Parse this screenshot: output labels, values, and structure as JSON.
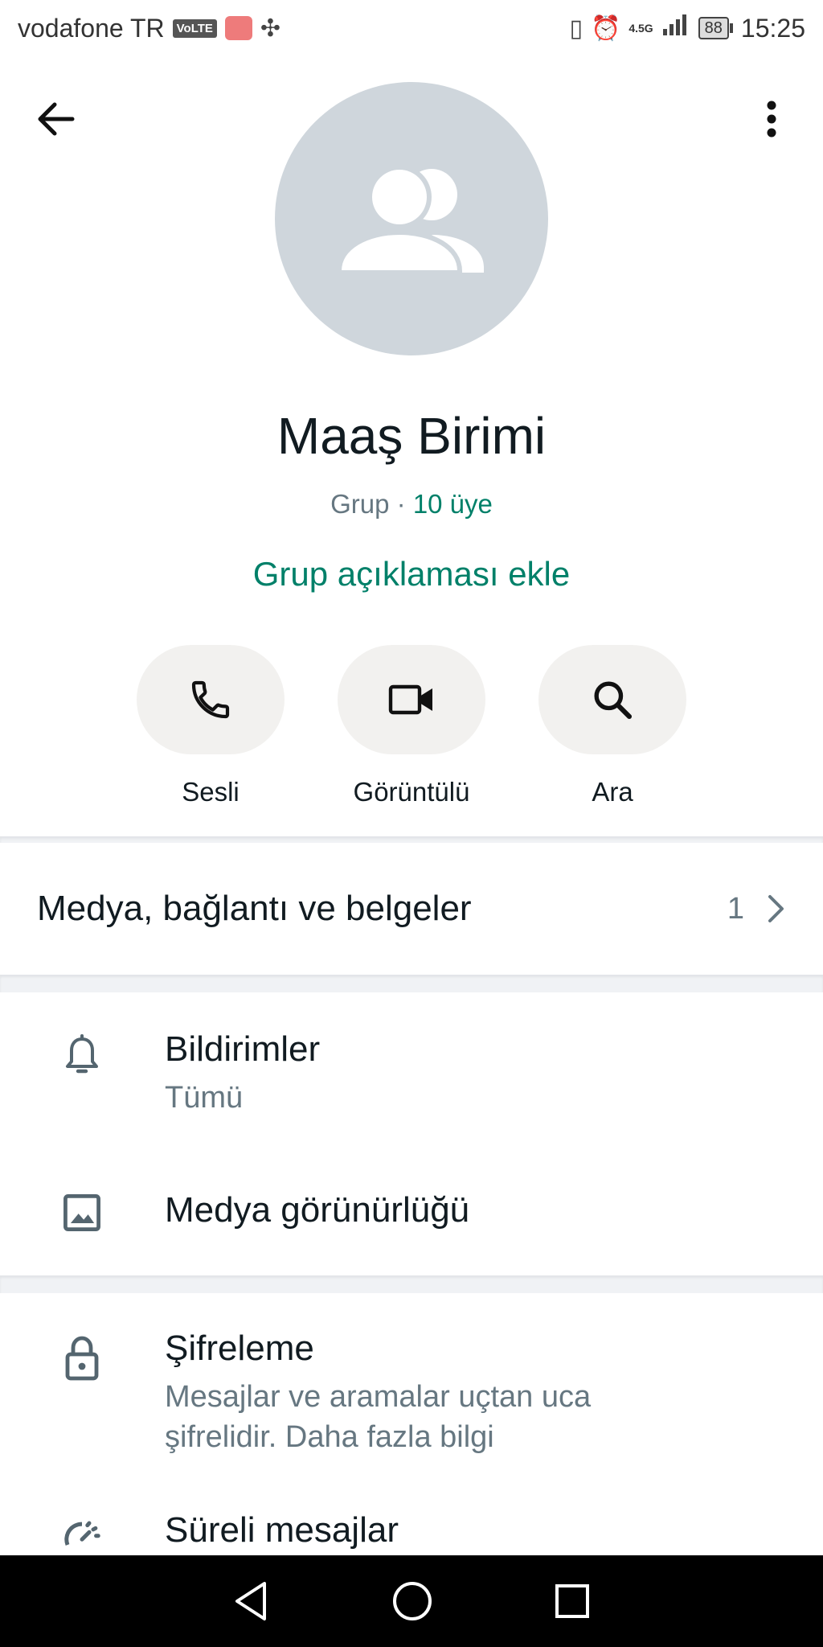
{
  "status_bar": {
    "carrier": "vodafone TR",
    "volte_badge": "VoLTE",
    "network": "4.5G",
    "battery": "88",
    "time": "15:25"
  },
  "header": {
    "back_icon": "arrow-left-icon",
    "menu_icon": "more-vert-icon"
  },
  "profile": {
    "avatar_icon": "group-avatar-icon",
    "name": "Maaş Birimi",
    "type": "Grup",
    "separator": "·",
    "members": "10 üye",
    "add_description": "Grup açıklaması ekle"
  },
  "actions": [
    {
      "label": "Sesli",
      "icon": "phone-icon"
    },
    {
      "label": "Görüntülü",
      "icon": "video-icon"
    },
    {
      "label": "Ara",
      "icon": "search-icon"
    }
  ],
  "media": {
    "label": "Medya, bağlantı ve belgeler",
    "count": "1",
    "icon": "chevron-right-icon"
  },
  "settings": [
    {
      "title": "Bildirimler",
      "subtitle": "Tümü",
      "icon": "bell-icon"
    },
    {
      "title": "Medya görünürlüğü",
      "subtitle": "",
      "icon": "image-icon"
    },
    {
      "title": "Şifreleme",
      "subtitle": "Mesajlar ve aramalar uçtan uca şifrelidir. Daha fazla bilgi",
      "icon": "lock-icon"
    },
    {
      "title": "Süreli mesajlar",
      "subtitle": "",
      "icon": "timer-icon"
    }
  ],
  "colors": {
    "accent": "#008069",
    "secondary_text": "#667781",
    "avatar_bg": "#cfd6dc",
    "pill_bg": "#f2f1ef"
  }
}
